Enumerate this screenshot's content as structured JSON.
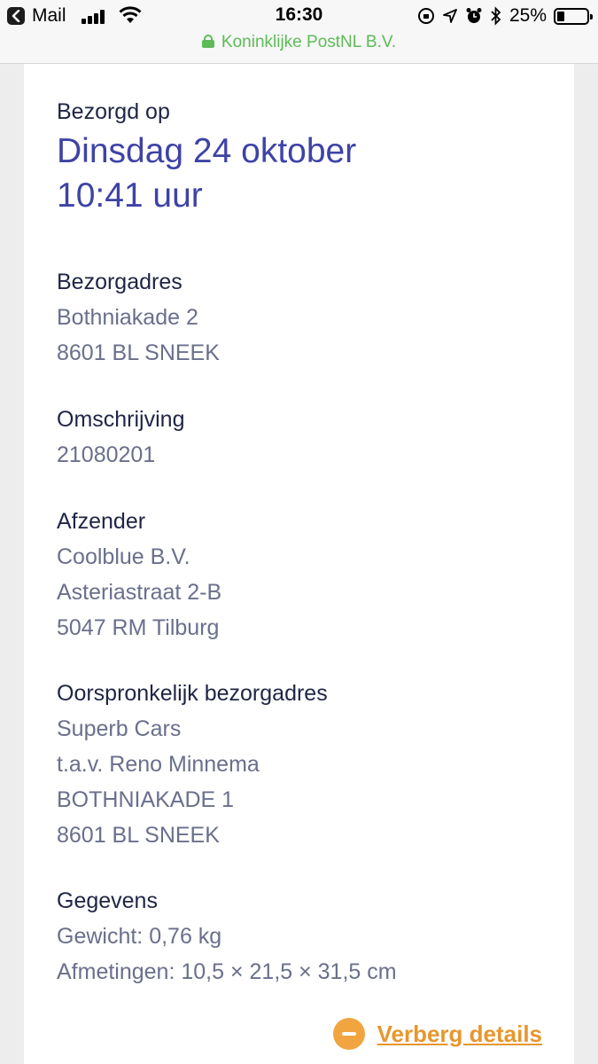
{
  "status_bar": {
    "back_app": "Mail",
    "time": "16:30",
    "battery": "25%"
  },
  "browser": {
    "url": "Koninklijke PostNL B.V."
  },
  "delivery": {
    "delivered_label": "Bezorgd op",
    "date": "Dinsdag 24 oktober",
    "time": "10:41 uur",
    "address_label": "Bezorgadres",
    "address_lines": [
      "Bothniakade 2",
      "8601 BL SNEEK"
    ],
    "description_label": "Omschrijving",
    "description": "21080201",
    "sender_label": "Afzender",
    "sender_lines": [
      "Coolblue B.V.",
      "Asteriastraat 2-B",
      "5047 RM Tilburg"
    ],
    "original_label": "Oorspronkelijk bezorgadres",
    "original_lines": [
      "Superb Cars",
      "t.a.v. Reno Minnema",
      "BOTHNIAKADE 1",
      "8601 BL SNEEK"
    ],
    "details_label": "Gegevens",
    "details_lines": [
      "Gewicht: 0,76 kg",
      "Afmetingen: 10,5 × 21,5 × 31,5 cm"
    ],
    "toggle_label": "Verberg details"
  },
  "colors": {
    "headline": "#3e43a6",
    "accent": "#e8962d",
    "secure": "#5dbb57"
  }
}
